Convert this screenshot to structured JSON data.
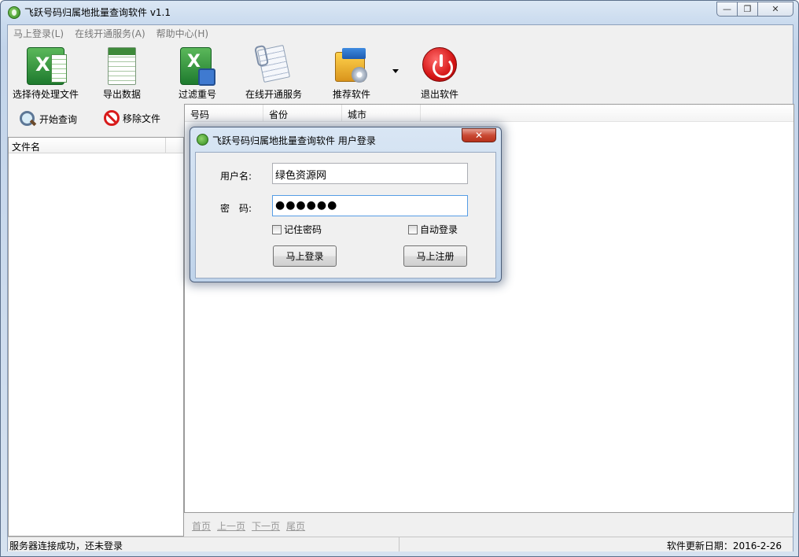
{
  "window": {
    "title": "飞跃号码归属地批量查询软件 v1.1",
    "minimize": "—",
    "maximize": "❐",
    "close": "✕"
  },
  "menu": {
    "items": [
      "马上登录(L)",
      "在线开通服务(A)",
      "帮助中心(H)"
    ]
  },
  "toolbar": {
    "select_file": "选择待处理文件",
    "export_data": "导出数据",
    "filter_dup": "过滤重号",
    "open_service": "在线开通服务",
    "recommend": "推荐软件",
    "exit": "退出软件"
  },
  "left": {
    "start_query": "开始查询",
    "remove_file": "移除文件",
    "file_col": "文件名"
  },
  "grid": {
    "columns": [
      "号码",
      "省份",
      "城市"
    ]
  },
  "pager": {
    "first": "首页",
    "prev": "上一页",
    "next": "下一页",
    "last": "尾页"
  },
  "status": {
    "left": "服务器连接成功，还未登录",
    "right": "软件更新日期：2016-2-26"
  },
  "dialog": {
    "title": "飞跃号码归属地批量查询软件 用户登录",
    "close": "✕",
    "username_label": "用户名:",
    "username_value": "绿色资源网",
    "password_label": "密　码:",
    "password_value": "●●●●●●",
    "remember": "记住密码",
    "auto_login": "自动登录",
    "login_btn": "马上登录",
    "register_btn": "马上注册"
  }
}
